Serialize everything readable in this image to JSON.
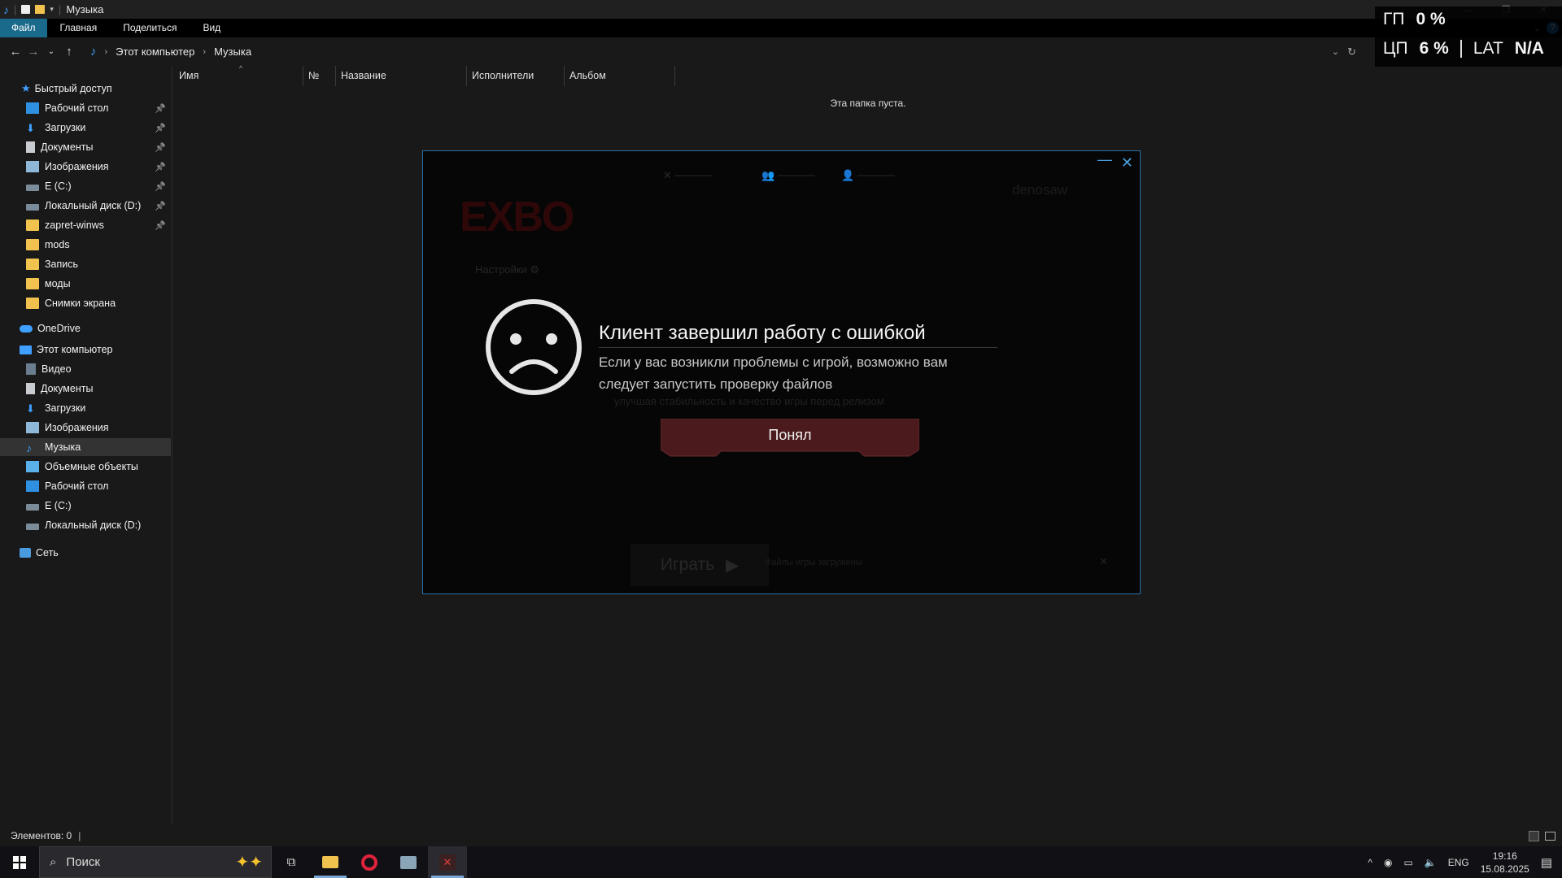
{
  "window": {
    "title": "Музыка"
  },
  "ribbon": {
    "tabs": [
      "Файл",
      "Главная",
      "Поделиться",
      "Вид"
    ]
  },
  "address": {
    "crumbs": [
      "Этот компьютер",
      "Музыка"
    ]
  },
  "sidebar": {
    "quick_access": "Быстрый доступ",
    "quick_items": [
      "Рабочий стол",
      "Загрузки",
      "Документы",
      "Изображения",
      "E (C:)",
      "Локальный диск (D:)",
      "zapret-winws",
      "mods",
      "Запись",
      "моды",
      "Снимки экрана"
    ],
    "onedrive": "OneDrive",
    "this_pc": "Этот компьютер",
    "pc_items": [
      "Видео",
      "Документы",
      "Загрузки",
      "Изображения",
      "Музыка",
      "Объемные объекты",
      "Рабочий стол",
      "E (C:)",
      "Локальный диск (D:)"
    ],
    "network": "Сеть",
    "selected": "Музыка"
  },
  "columns": [
    "Имя",
    "№",
    "Название",
    "Исполнители",
    "Альбом"
  ],
  "empty_message": "Эта папка пуста.",
  "hud": {
    "gpu_label": "ГП",
    "gpu_value": "0 %",
    "cpu_label": "ЦП",
    "cpu_value": "6 %",
    "lat_label": "LAT",
    "lat_value": "N/A"
  },
  "status": {
    "items_label": "Элементов: 0"
  },
  "taskbar": {
    "search_placeholder": "Поиск",
    "time": "19:16",
    "date": "15.08.2025",
    "lang": "ENG"
  },
  "dialog": {
    "title": "Клиент завершил работу с ошибкой",
    "body": "Если у вас возникли проблемы с игрой, возможно вам следует запустить проверку файлов",
    "ok_button": "Понял"
  },
  "launcher_bg": {
    "logo": "EXBO",
    "settings": "Настройки",
    "user": "denosaw",
    "play": "Играть",
    "status": "Файлы игры загружены",
    "desc": "улучшая стабильность и качество игры перед релизом"
  },
  "colors": {
    "accent": "#2a6fa6",
    "ok_button": "#4a1a1c"
  }
}
